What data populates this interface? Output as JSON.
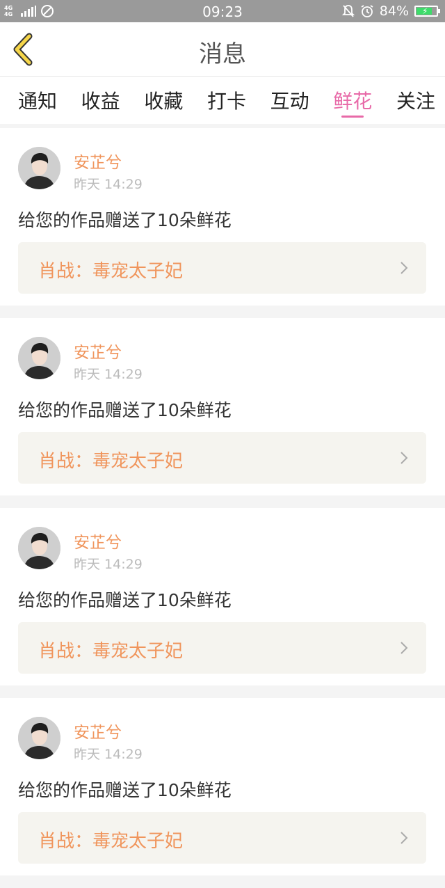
{
  "status": {
    "network": "4G 4G",
    "time": "09:23",
    "battery": "84%",
    "battery_level": 0.84
  },
  "header": {
    "title": "消息",
    "back_icon": "back-chevron-icon"
  },
  "tabs": [
    {
      "label": "通知"
    },
    {
      "label": "收益"
    },
    {
      "label": "收藏"
    },
    {
      "label": "打卡"
    },
    {
      "label": "互动"
    },
    {
      "label": "鲜花",
      "active": true
    },
    {
      "label": "关注"
    }
  ],
  "colors": {
    "accent": "#e86aa8",
    "name": "#f0955c"
  },
  "messages": [
    {
      "user": "安芷兮",
      "time": "昨天 14:29",
      "text": "给您的作品赠送了10朵鲜花",
      "work": "肖战：毒宠太子妃"
    },
    {
      "user": "安芷兮",
      "time": "昨天 14:29",
      "text": "给您的作品赠送了10朵鲜花",
      "work": "肖战：毒宠太子妃"
    },
    {
      "user": "安芷兮",
      "time": "昨天 14:29",
      "text": "给您的作品赠送了10朵鲜花",
      "work": "肖战：毒宠太子妃"
    },
    {
      "user": "安芷兮",
      "time": "昨天 14:29",
      "text": "给您的作品赠送了10朵鲜花",
      "work": "肖战：毒宠太子妃"
    }
  ]
}
